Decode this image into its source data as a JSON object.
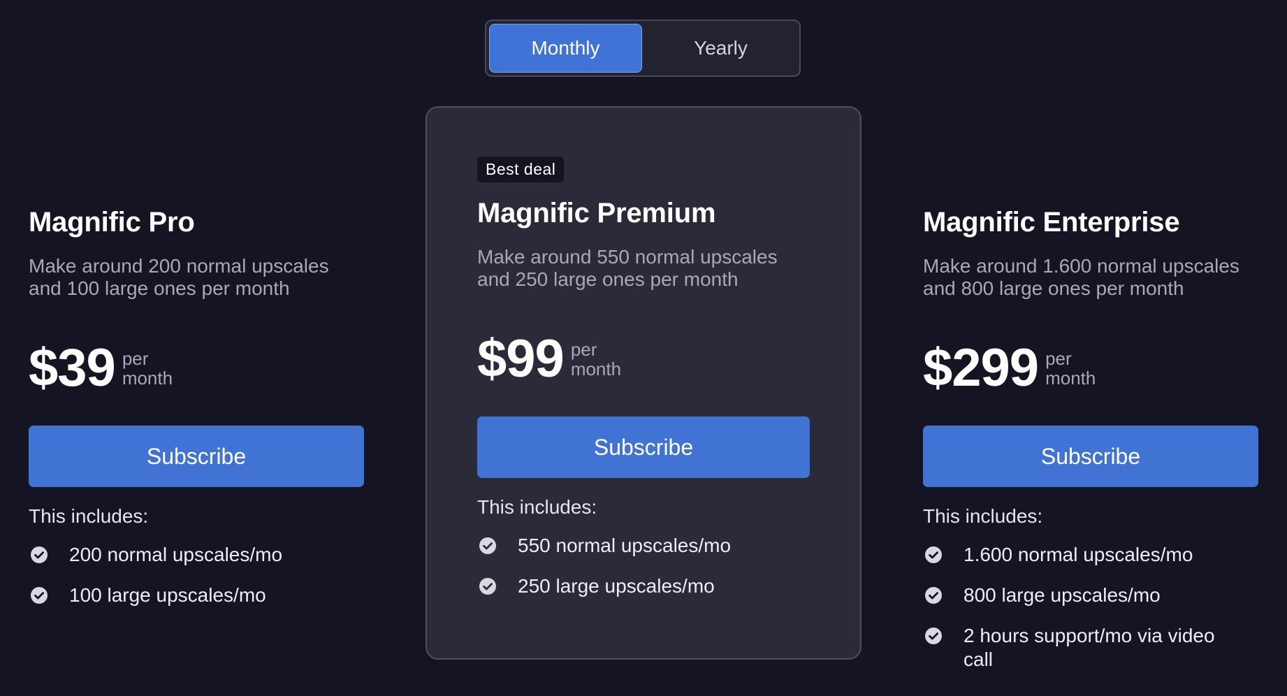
{
  "toggle": {
    "options": [
      "Monthly",
      "Yearly"
    ],
    "selected": "Monthly"
  },
  "plans": [
    {
      "name": "Magnific Pro",
      "description_line1": "Make around 200 normal upscales",
      "description_line2": "and 100 large ones per month",
      "price": "$39",
      "per_line1": "per",
      "per_line2": "month",
      "cta": "Subscribe",
      "includes_label": "This includes:",
      "features": [
        "200 normal upscales/mo",
        "100 large upscales/mo"
      ]
    },
    {
      "badge": "Best deal",
      "name": "Magnific Premium",
      "description_line1": "Make around 550 normal upscales",
      "description_line2": "and 250 large ones per month",
      "price": "$99",
      "per_line1": "per",
      "per_line2": "month",
      "cta": "Subscribe",
      "includes_label": "This includes:",
      "features": [
        "550 normal upscales/mo",
        "250 large upscales/mo"
      ]
    },
    {
      "name": "Magnific Enterprise",
      "description_line1": "Make around 1.600 normal upscales",
      "description_line2": "and 800 large ones per month",
      "price": "$299",
      "per_line1": "per",
      "per_line2": "month",
      "cta": "Subscribe",
      "includes_label": "This includes:",
      "features": [
        "1.600 normal upscales/mo",
        "800 large upscales/mo",
        "2 hours support/mo via video call"
      ]
    }
  ],
  "colors": {
    "background": "#151423",
    "accent": "#4173d4",
    "featured_card": "#2b2a39",
    "muted_text": "#a9a8b6"
  },
  "icons": {
    "feature": "check-circle-icon"
  }
}
